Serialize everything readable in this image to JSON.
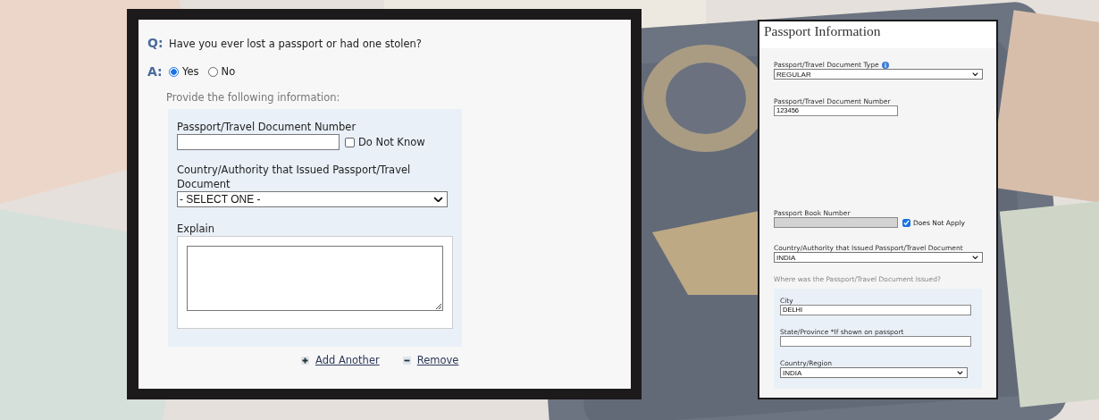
{
  "left_form": {
    "question": {
      "marker": "Q:",
      "text": "Have you ever lost a passport or had one stolen?"
    },
    "answer": {
      "marker": "A:",
      "options": [
        {
          "label": "Yes",
          "selected": true
        },
        {
          "label": "No",
          "selected": false
        }
      ]
    },
    "instruction": "Provide the following information:",
    "document_number": {
      "label": "Passport/Travel Document Number",
      "checkbox": {
        "label": "Do Not Know",
        "checked": false
      }
    },
    "country": {
      "label": "Country/Authority that Issued Passport/Travel Document",
      "value": "- SELECT ONE -"
    },
    "explain": {
      "label": "Explain"
    },
    "actions": [
      {
        "kind": "add",
        "label": "Add Another"
      },
      {
        "kind": "remove",
        "label": "Remove"
      }
    ]
  },
  "right_form": {
    "title": "Passport Information",
    "fields": [
      {
        "kind": "select",
        "label": "Passport/Travel Document Type",
        "info": true,
        "value": "REGULAR"
      },
      {
        "kind": "input",
        "label": "Passport/Travel Document Number",
        "value": "123456"
      },
      {
        "kind": "disabled_input",
        "label": "Passport Book Number",
        "checkbox": {
          "label": "Does Not Apply",
          "checked": true
        }
      },
      {
        "kind": "select",
        "label": "Country/Authority that Issued Passport/Travel Document",
        "info": false,
        "value": "INDIA"
      }
    ],
    "issued": {
      "note": "Where was the Passport/Travel Document Issued?",
      "fields": [
        {
          "kind": "input",
          "label": "City",
          "value": "DELHI"
        },
        {
          "kind": "input",
          "label": "State/Province *If shown on passport"
        },
        {
          "kind": "select",
          "label": "Country/Region",
          "value": "INDIA"
        }
      ]
    }
  }
}
